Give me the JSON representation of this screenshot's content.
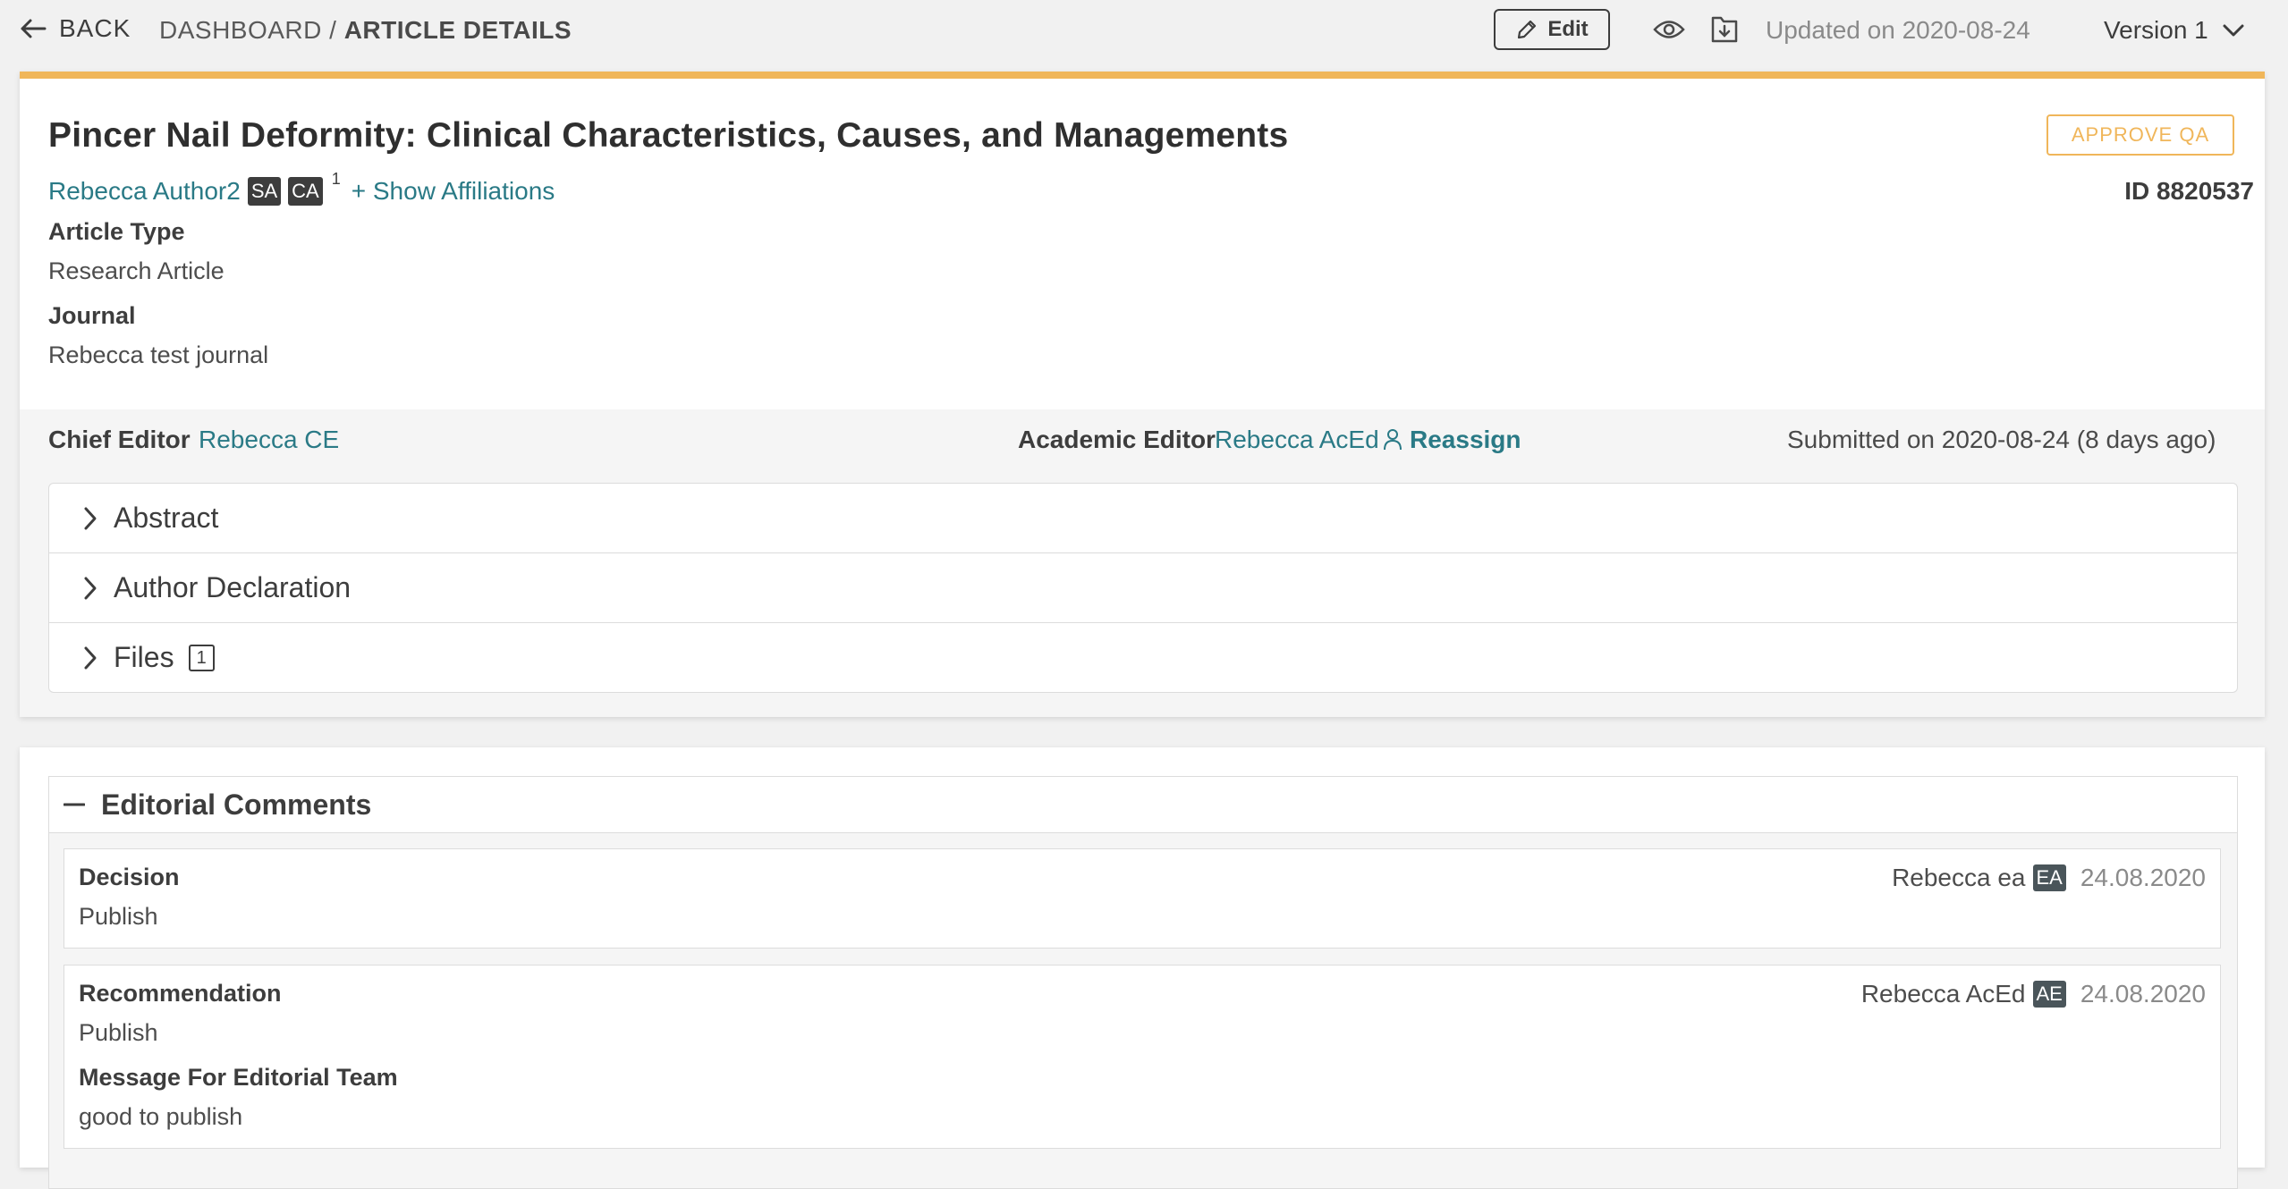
{
  "topbar": {
    "back_label": "BACK",
    "breadcrumb_root": "DASHBOARD / ",
    "breadcrumb_current": "ARTICLE DETAILS",
    "edit_label": "Edit",
    "updated": "Updated on 2020-08-24",
    "version": "Version 1"
  },
  "article": {
    "title": "Pincer Nail Deformity: Clinical Characteristics, Causes, and Managements",
    "approve_label": "APPROVE QA",
    "author_name": "Rebecca Author2",
    "author_badges": [
      "SA",
      "CA"
    ],
    "author_sup": "1",
    "show_affiliations": "+ Show Affiliations",
    "id": "ID 8820537",
    "type_label": "Article Type",
    "type_value": "Research Article",
    "journal_label": "Journal",
    "journal_value": "Rebecca test journal"
  },
  "editors": {
    "chief_label": "Chief Editor",
    "chief_name": "Rebecca CE",
    "academic_label": "Academic Editor",
    "academic_name": "Rebecca AcEd",
    "reassign": "Reassign",
    "submitted": "Submitted on 2020-08-24 (8 days ago)"
  },
  "accordion": [
    {
      "label": "Abstract"
    },
    {
      "label": "Author Declaration"
    },
    {
      "label": "Files",
      "count": "1"
    }
  ],
  "editorial_comments": {
    "title": "Editorial Comments",
    "items": [
      {
        "label": "Decision",
        "value": "Publish",
        "author": "Rebecca ea",
        "role": "EA",
        "date": "24.08.2020"
      },
      {
        "label": "Recommendation",
        "value": "Publish",
        "author": "Rebecca AcEd",
        "role": "AE",
        "date": "24.08.2020",
        "extra_label": "Message For Editorial Team",
        "extra_value": "good to publish"
      }
    ]
  },
  "colors": {
    "accent": "#f0b65a",
    "link": "#2a7a86"
  }
}
